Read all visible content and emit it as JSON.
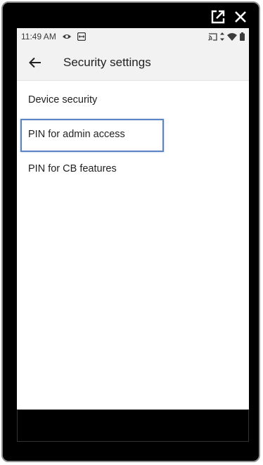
{
  "status_bar": {
    "time": "11:49 AM",
    "icons": [
      "eye-icon",
      "teamviewer-icon",
      "cast-icon",
      "data-arrows-icon",
      "wifi-icon",
      "battery-icon"
    ]
  },
  "window_controls": {
    "icons": [
      "open-external-icon",
      "close-icon"
    ]
  },
  "app_bar": {
    "back_icon": "arrow-left-icon",
    "title": "Security settings"
  },
  "menu": {
    "items": [
      {
        "label": "Device security"
      },
      {
        "label": "PIN for admin access",
        "highlighted": true
      },
      {
        "label": "PIN for CB features"
      }
    ]
  },
  "colors": {
    "device_frame": "#000000",
    "app_bar_bg": "#f2f2f2",
    "highlight_border": "#5b84c4",
    "text": "#222222"
  }
}
